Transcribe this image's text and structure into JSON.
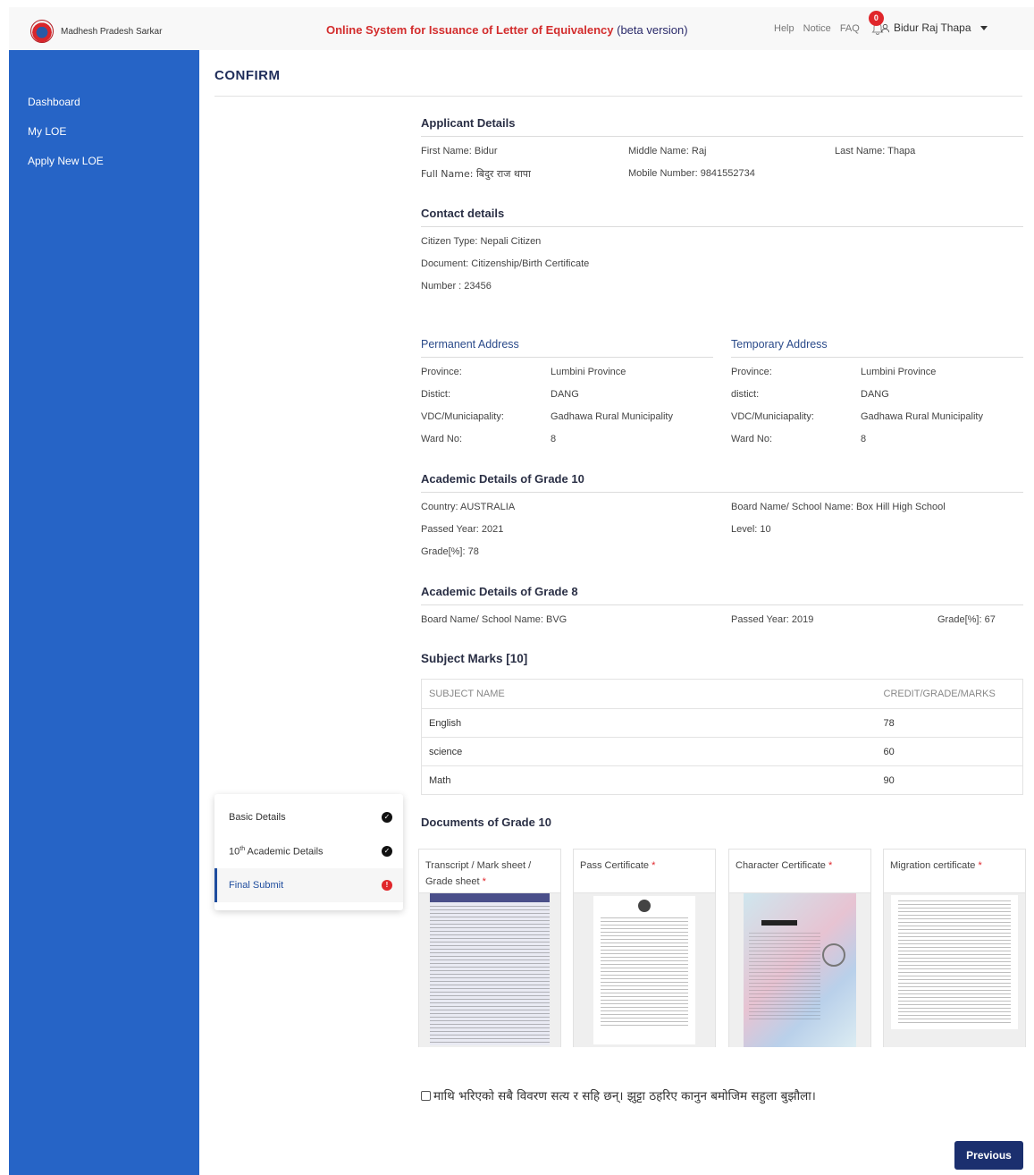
{
  "header": {
    "brand_name": "Madhesh Pradesh Sarkar",
    "title": "Online System for Issuance of Letter of Equivalency",
    "title_suffix": "(beta version)",
    "links": [
      "Help",
      "Notice",
      "FAQ"
    ],
    "notification_count": "0",
    "user_name": "Bidur Raj Thapa"
  },
  "sidebar": {
    "items": [
      {
        "label": "Dashboard"
      },
      {
        "label": "My LOE"
      },
      {
        "label": "Apply New LOE"
      }
    ]
  },
  "page": {
    "title": "CONFIRM"
  },
  "applicant": {
    "heading": "Applicant Details",
    "first_name": "First Name: Bidur",
    "middle_name": "Middle Name: Raj",
    "last_name": "Last Name: Thapa",
    "full_name": "Full Name: बिदुर राज थापा",
    "mobile": "Mobile Number: 9841552734"
  },
  "contact": {
    "heading": "Contact details",
    "citizen_type": "Citizen Type: Nepali Citizen",
    "document": "Document: Citizenship/Birth Certificate",
    "number": "Number : 23456"
  },
  "permanent_address": {
    "heading": "Permanent Address",
    "province_label": "Province:",
    "province": "Lumbini Province",
    "district_label": "Distict:",
    "district": "DANG",
    "vdc_label": "VDC/Municiapality:",
    "vdc": "Gadhawa Rural Municipality",
    "ward_label": "Ward No:",
    "ward": "8"
  },
  "temporary_address": {
    "heading": "Temporary Address",
    "province_label": "Province:",
    "province": "Lumbini Province",
    "district_label": "distict:",
    "district": "DANG",
    "vdc_label": "VDC/Municiapality:",
    "vdc": "Gadhawa Rural Municipality",
    "ward_label": "Ward No:",
    "ward": "8"
  },
  "grade10": {
    "heading": "Academic Details of Grade 10",
    "country": "Country: AUSTRALIA",
    "board": "Board Name/ School Name: Box Hill High School",
    "passed_year": "Passed Year: 2021",
    "level": "Level: 10",
    "grade": "Grade[%]: 78"
  },
  "grade8": {
    "heading": "Academic Details of Grade 8",
    "board": "Board Name/ School Name: BVG",
    "passed_year": "Passed Year: 2019",
    "grade": "Grade[%]: 67"
  },
  "subjects": {
    "heading": "Subject Marks [10]",
    "col_name": "SUBJECT NAME",
    "col_marks": "CREDIT/GRADE/MARKS",
    "rows": [
      {
        "name": "English",
        "marks": "78"
      },
      {
        "name": "science",
        "marks": "60"
      },
      {
        "name": "Math",
        "marks": "90"
      }
    ]
  },
  "stepper": {
    "steps": [
      {
        "label": "Basic Details"
      },
      {
        "label_pre": "10",
        "label_sup": "th",
        "label_post": " Academic Details"
      },
      {
        "label": "Final Submit"
      }
    ]
  },
  "documents": {
    "heading": "Documents of Grade 10",
    "items": [
      {
        "label": "Transcript / Mark sheet / Grade sheet",
        "required": "*"
      },
      {
        "label": "Pass Certificate",
        "required": "*"
      },
      {
        "label": "Character Certificate",
        "required": "*"
      },
      {
        "label": "Migration certificate",
        "required": "*"
      }
    ]
  },
  "declaration": "माथि भरिएको सबै विवरण सत्य र सहि छन्। झुट्टा ठहरिए कानुन बमोजिम सहुला बुझौला।",
  "actions": {
    "previous": "Previous"
  }
}
